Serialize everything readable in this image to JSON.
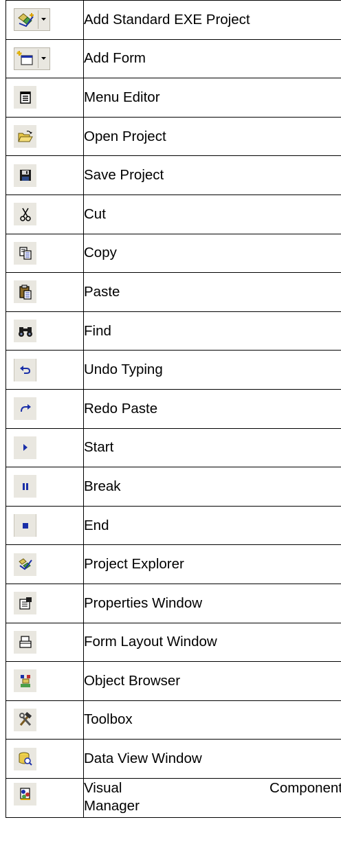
{
  "rows": [
    {
      "label": "Add Standard EXE Project",
      "icon": "add-standard-exe-project-icon"
    },
    {
      "label": "Add Form",
      "icon": "add-form-icon"
    },
    {
      "label": "Menu Editor",
      "icon": "menu-editor-icon"
    },
    {
      "label": "Open Project",
      "icon": "open-folder-icon"
    },
    {
      "label": "Save Project",
      "icon": "floppy-disk-icon"
    },
    {
      "label": "Cut",
      "icon": "scissors-icon"
    },
    {
      "label": "Copy",
      "icon": "copy-icon"
    },
    {
      "label": "Paste",
      "icon": "clipboard-icon"
    },
    {
      "label": "Find",
      "icon": "binoculars-icon"
    },
    {
      "label": "Undo Typing",
      "icon": "undo-arrow-icon"
    },
    {
      "label": "Redo Paste",
      "icon": "redo-arrow-icon"
    },
    {
      "label": "Start",
      "icon": "play-triangle-icon"
    },
    {
      "label": "Break",
      "icon": "pause-bars-icon"
    },
    {
      "label": "End",
      "icon": "stop-square-icon"
    },
    {
      "label": "Project Explorer",
      "icon": "project-explorer-icon"
    },
    {
      "label": "Properties Window",
      "icon": "properties-window-icon"
    },
    {
      "label": "Form Layout Window",
      "icon": "form-layout-icon"
    },
    {
      "label": "Object Browser",
      "icon": "object-browser-icon"
    },
    {
      "label": "Toolbox",
      "icon": "hammer-wrench-icon"
    },
    {
      "label": "Data View Window",
      "icon": "data-view-icon"
    },
    {
      "label_line1_left": "Visual",
      "label_line1_right": "Component",
      "label_line2": "Manager",
      "icon": "visual-component-manager-icon"
    }
  ],
  "colors": {
    "icon_background": "#e9e7e0",
    "border": "#000000",
    "accent_blue": "#1a2fa8"
  }
}
